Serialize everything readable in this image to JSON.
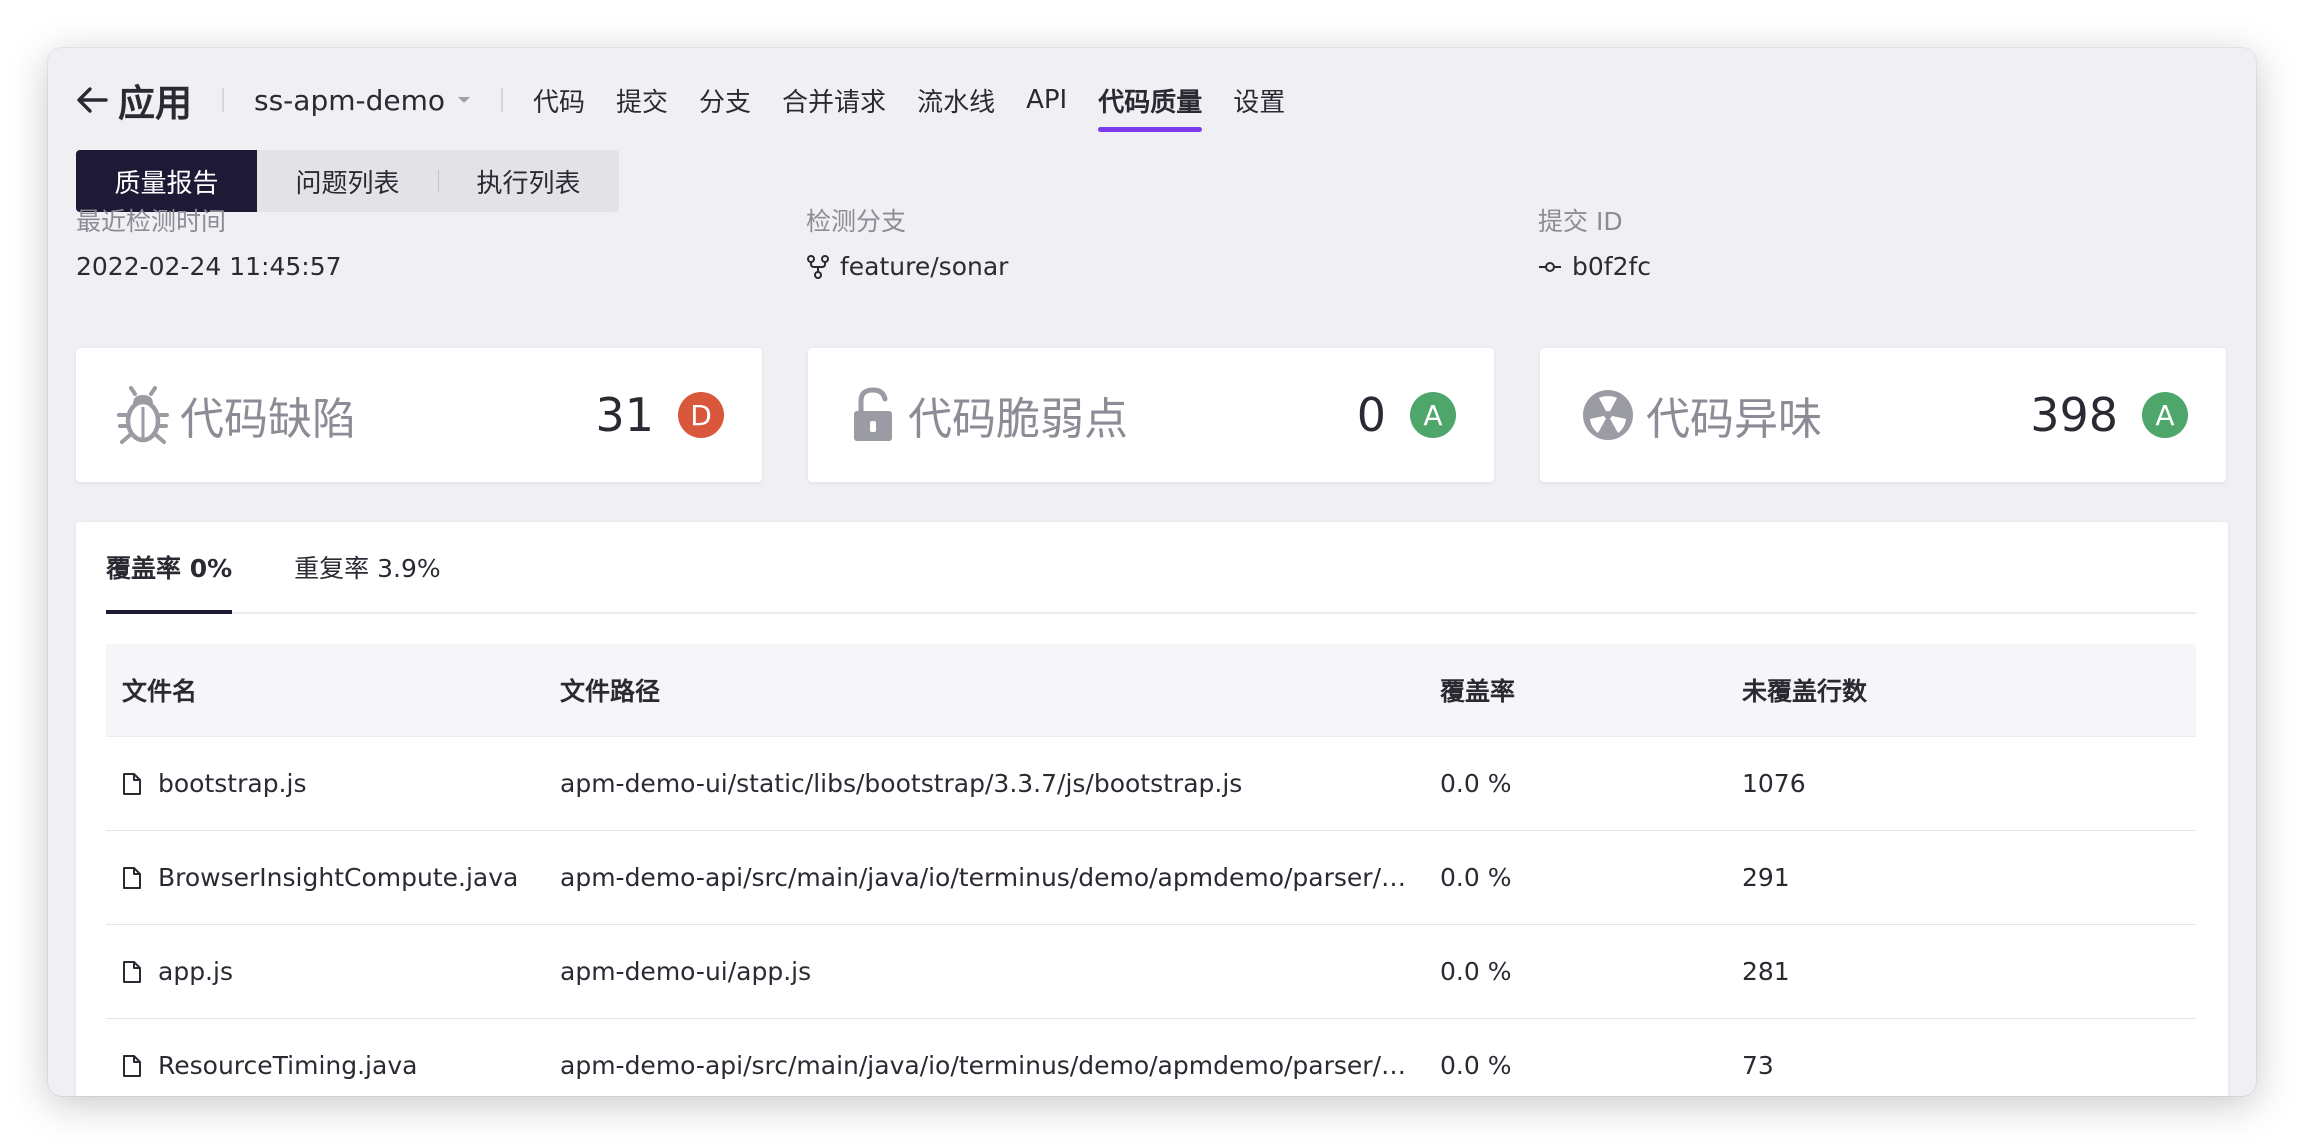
{
  "nav": {
    "back_label": "应用",
    "repo_name": "ss-apm-demo",
    "links": [
      "代码",
      "提交",
      "分支",
      "合并请求",
      "流水线",
      "API",
      "代码质量",
      "设置"
    ],
    "active_link": "代码质量"
  },
  "subtabs": {
    "items": [
      "质量报告",
      "问题列表",
      "执行列表"
    ],
    "active": "质量报告"
  },
  "meta": {
    "last_check_label": "最近检测时间",
    "last_check_value": "2022-02-24 11:45:57",
    "branch_label": "检测分支",
    "branch_value": "feature/sonar",
    "commit_label": "提交 ID",
    "commit_value": "b0f2fc"
  },
  "cards": [
    {
      "title": "代码缺陷",
      "count": "31",
      "grade": "D",
      "grade_color": "#d9583b",
      "icon": "bug-icon"
    },
    {
      "title": "代码脆弱点",
      "count": "0",
      "grade": "A",
      "grade_color": "#4ea66a",
      "icon": "unlock-icon"
    },
    {
      "title": "代码异味",
      "count": "398",
      "grade": "A",
      "grade_color": "#4ea66a",
      "icon": "smell-icon"
    }
  ],
  "panel": {
    "tabs": [
      "覆盖率 0%",
      "重复率 3.9%"
    ],
    "active_tab": "覆盖率 0%",
    "columns": [
      "文件名",
      "文件路径",
      "覆盖率",
      "未覆盖行数"
    ],
    "rows": [
      {
        "name": "bootstrap.js",
        "path": "apm-demo-ui/static/libs/bootstrap/3.3.7/js/bootstrap.js",
        "coverage": "0.0 %",
        "uncovered": "1076"
      },
      {
        "name": "BrowserInsightCompute.java",
        "path": "apm-demo-api/src/main/java/io/terminus/demo/apmdemo/parser/Br...",
        "coverage": "0.0 %",
        "uncovered": "291"
      },
      {
        "name": "app.js",
        "path": "apm-demo-ui/app.js",
        "coverage": "0.0 %",
        "uncovered": "281"
      },
      {
        "name": "ResourceTiming.java",
        "path": "apm-demo-api/src/main/java/io/terminus/demo/apmdemo/parser/uti...",
        "coverage": "0.0 %",
        "uncovered": "73"
      }
    ]
  }
}
